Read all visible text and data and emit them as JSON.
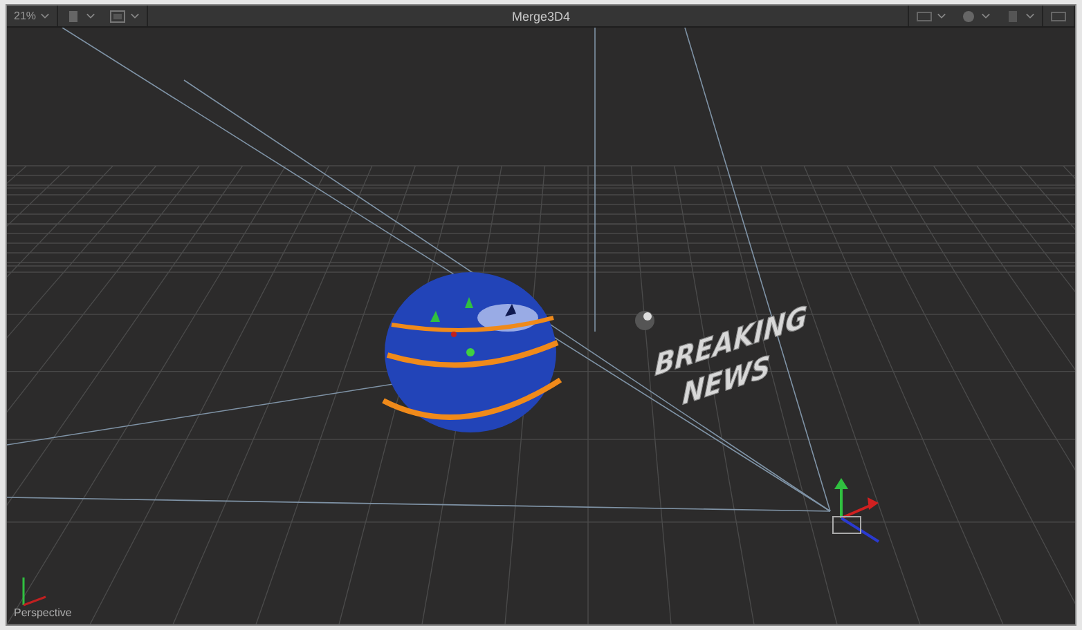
{
  "toolbar": {
    "zoom": "21%",
    "title": "Merge3D4"
  },
  "viewport": {
    "view_label": "Perspective",
    "scene_text": [
      "BREAKING",
      "NEWS"
    ]
  }
}
